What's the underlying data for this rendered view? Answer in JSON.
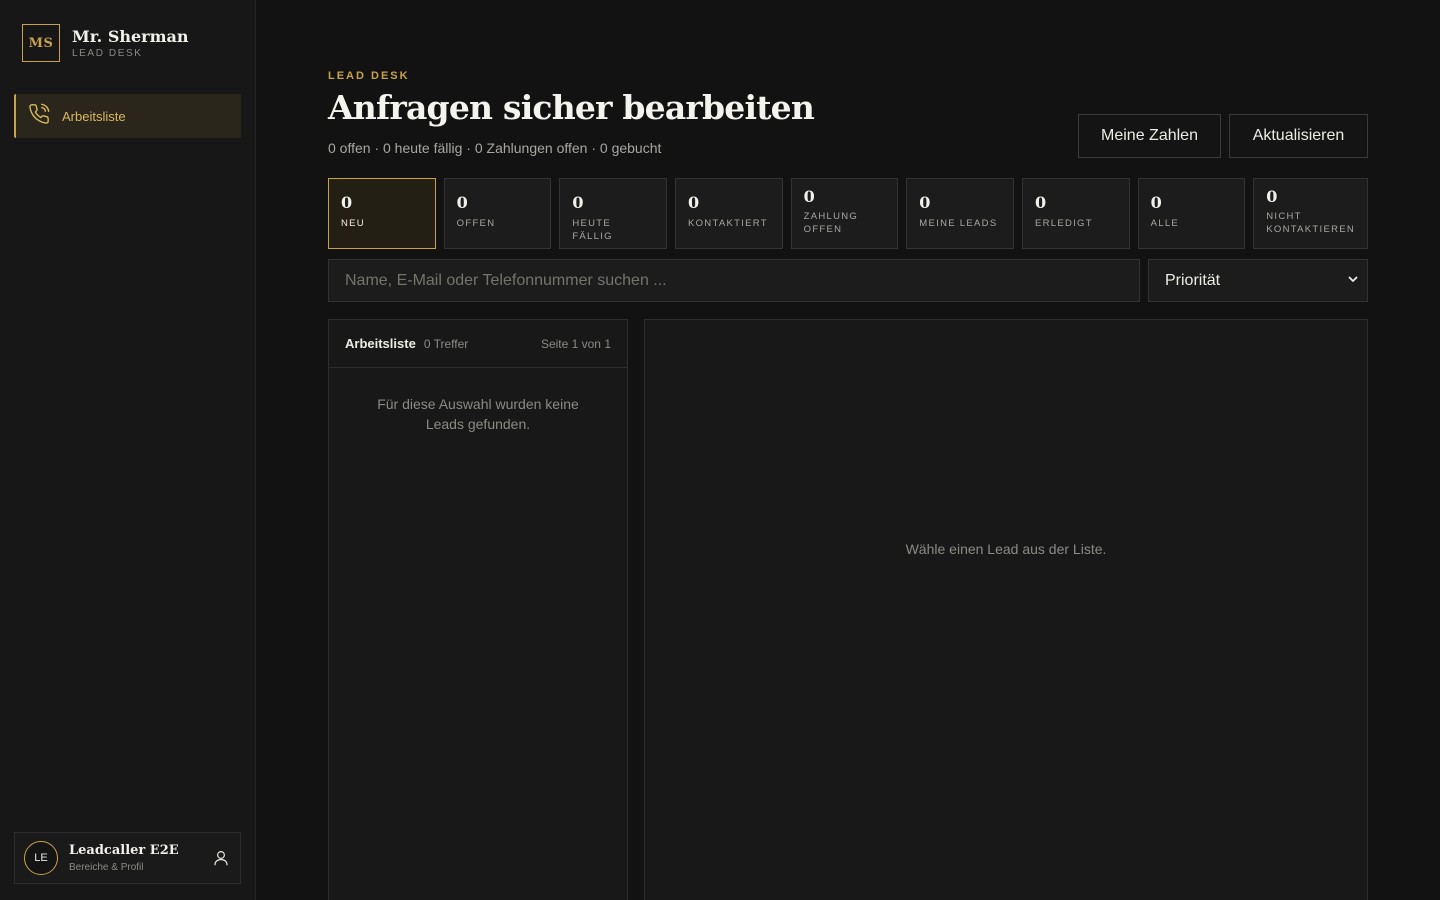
{
  "brand": {
    "mark": "MS",
    "name": "Mr. Sherman",
    "subtitle": "LEAD DESK"
  },
  "nav": {
    "items": [
      {
        "label": "Arbeitsliste",
        "icon": "phone-icon",
        "active": true
      }
    ]
  },
  "user": {
    "initials": "LE",
    "name": "Leadcaller E2E",
    "subtitle": "Bereiche & Profil",
    "icon": "user-icon"
  },
  "header": {
    "eyebrow": "LEAD DESK",
    "title": "Anfragen sicher bearbeiten",
    "summary": "0 offen · 0 heute fällig · 0 Zahlungen offen · 0 gebucht"
  },
  "actions": {
    "stats_label": "Meine Zahlen",
    "refresh_label": "Aktualisieren"
  },
  "tiles": [
    {
      "count": "0",
      "label": "NEU",
      "active": true
    },
    {
      "count": "0",
      "label": "OFFEN"
    },
    {
      "count": "0",
      "label": "HEUTE FÄLLIG"
    },
    {
      "count": "0",
      "label": "KONTAKTIERT"
    },
    {
      "count": "0",
      "label": "ZAHLUNG OFFEN"
    },
    {
      "count": "0",
      "label": "MEINE LEADS"
    },
    {
      "count": "0",
      "label": "ERLEDIGT"
    },
    {
      "count": "0",
      "label": "ALLE"
    },
    {
      "count": "0",
      "label": "NICHT KONTAKTIEREN"
    }
  ],
  "search": {
    "placeholder": "Name, E-Mail oder Telefonnummer suchen ..."
  },
  "sort": {
    "selected": "Priorität"
  },
  "list": {
    "title": "Arbeitsliste",
    "hits": "0 Treffer",
    "page": "Seite 1 von 1",
    "empty": "Für diese Auswahl wurden keine Leads gefunden."
  },
  "detail": {
    "empty": "Wähle einen Lead aus der Liste."
  },
  "colors": {
    "accent": "#c9a24a",
    "background": "#121212",
    "panel": "#181818"
  }
}
